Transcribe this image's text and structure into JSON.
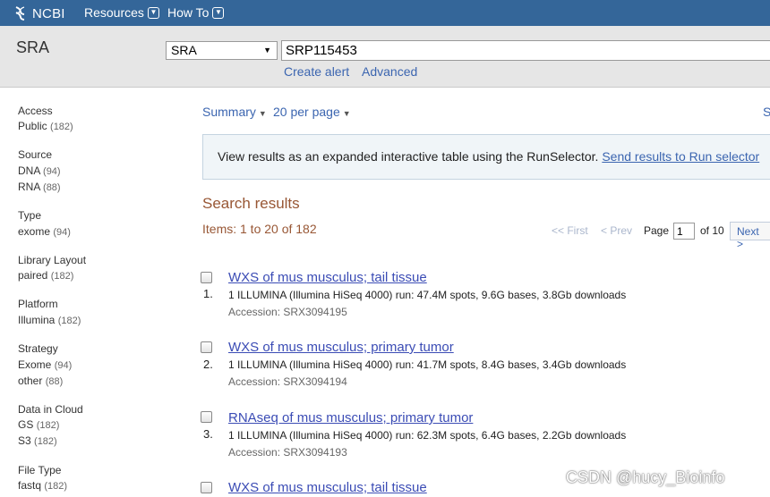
{
  "topbar": {
    "logo_text": "NCBI",
    "nav": [
      {
        "label": "Resources"
      },
      {
        "label": "How To"
      }
    ]
  },
  "search": {
    "db_title": "SRA",
    "db_selected": "SRA",
    "term": "SRP115453",
    "links": [
      {
        "label": "Create alert"
      },
      {
        "label": "Advanced"
      }
    ]
  },
  "facets": [
    {
      "title": "Access",
      "items": [
        {
          "label": "Public",
          "count": "(182)"
        }
      ]
    },
    {
      "title": "Source",
      "items": [
        {
          "label": "DNA",
          "count": "(94)"
        },
        {
          "label": "RNA",
          "count": "(88)"
        }
      ]
    },
    {
      "title": "Type",
      "items": [
        {
          "label": "exome",
          "count": "(94)"
        }
      ]
    },
    {
      "title": "Library Layout",
      "items": [
        {
          "label": "paired",
          "count": "(182)"
        }
      ]
    },
    {
      "title": "Platform",
      "items": [
        {
          "label": "Illumina",
          "count": "(182)"
        }
      ]
    },
    {
      "title": "Strategy",
      "items": [
        {
          "label": "Exome",
          "count": "(94)"
        },
        {
          "label": "other",
          "count": "(88)"
        }
      ]
    },
    {
      "title": "Data in Cloud",
      "items": [
        {
          "label": "GS",
          "count": "(182)"
        },
        {
          "label": "S3",
          "count": "(182)"
        }
      ]
    },
    {
      "title": "File Type",
      "items": [
        {
          "label": "fastq",
          "count": "(182)"
        }
      ]
    }
  ],
  "display": {
    "format": "Summary",
    "per_page": "20 per page",
    "edge_letter": "S"
  },
  "runselector": {
    "text": "View results as an expanded interactive table using the RunSelector. ",
    "link": "Send results to Run selector"
  },
  "results": {
    "title": "Search results",
    "items_count": "Items: 1 to 20 of 182",
    "pager": {
      "first": "<< First",
      "prev": "< Prev",
      "page_label": "Page",
      "page_value": "1",
      "of_label": "of 10",
      "next": "Next >"
    },
    "list": [
      {
        "num": "1.",
        "title": "WXS of mus musculus; tail tissue",
        "desc": "1 ILLUMINA (Illumina HiSeq 4000) run: 47.4M spots, 9.6G bases, 3.8Gb downloads",
        "accession": "Accession: SRX3094195"
      },
      {
        "num": "2.",
        "title": "WXS of mus musculus; primary tumor",
        "desc": "1 ILLUMINA (Illumina HiSeq 4000) run: 41.7M spots, 8.4G bases, 3.4Gb downloads",
        "accession": "Accession: SRX3094194"
      },
      {
        "num": "3.",
        "title": "RNAseq of mus musculus; primary tumor",
        "desc": "1 ILLUMINA (Illumina HiSeq 4000) run: 62.3M spots, 6.4G bases, 2.2Gb downloads",
        "accession": "Accession: SRX3094193"
      },
      {
        "num": "",
        "title": "WXS of mus musculus; tail tissue",
        "desc": "",
        "accession": ""
      }
    ]
  },
  "watermark": "CSDN @hucy_Bioinfo",
  "colors": {
    "topbar": "#346699",
    "link": "#3b65b0",
    "result_title": "#985735"
  }
}
